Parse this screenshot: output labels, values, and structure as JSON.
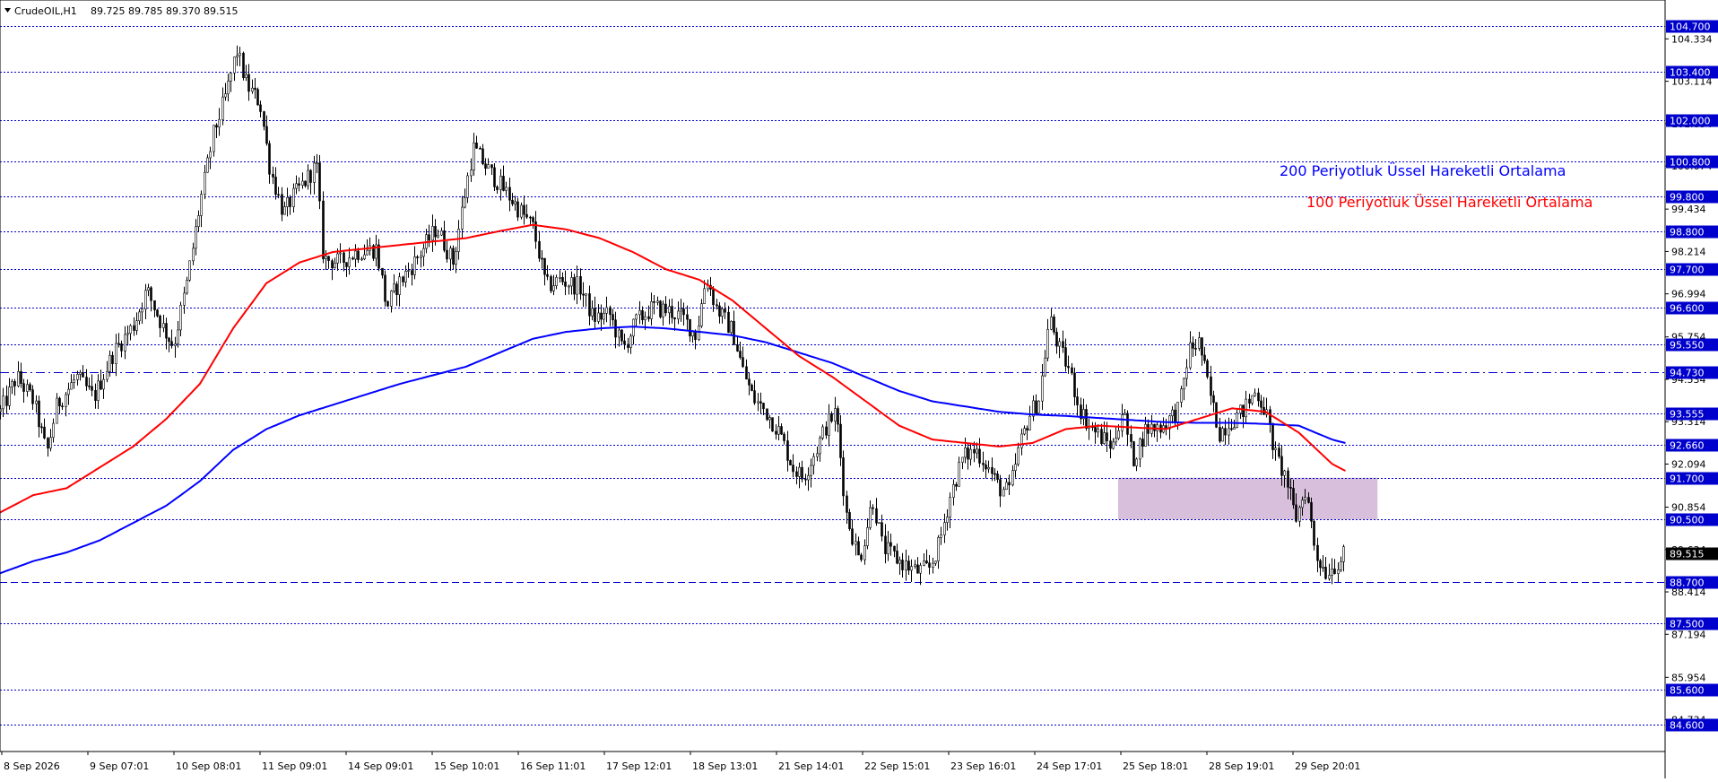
{
  "header": {
    "symbol": "CrudeOIL,H1",
    "ohlc": "89.725 89.785 89.370 89.515"
  },
  "colors": {
    "ema200": "#0000ff",
    "ema100": "#ff0000",
    "level_line": "#0000cc",
    "price_tag": "#0000cc",
    "current_tag": "#000000",
    "zone": "#d8c0dc",
    "candle": "#000000"
  },
  "annotations": {
    "ema200_label": "200 Periyotluk Üssel Hareketli Ortalama",
    "ema100_label": "100 Periyotluk Üssel Hareketli Ortalama"
  },
  "chart_data": {
    "type": "candlestick",
    "title": "",
    "ylim": [
      84.0,
      105.35
    ],
    "x_tick_labels": [
      "8 Sep 2026",
      "9 Sep 07:01",
      "10 Sep 08:01",
      "11 Sep 09:01",
      "14 Sep 09:01",
      "15 Sep 10:01",
      "16 Sep 11:01",
      "17 Sep 12:01",
      "18 Sep 13:01",
      "21 Sep 14:01",
      "22 Sep 15:01",
      "23 Sep 16:01",
      "24 Sep 17:01",
      "25 Sep 18:01",
      "28 Sep 19:01",
      "29 Sep 20:01"
    ],
    "y_tick_labels": [
      104.334,
      103.114,
      101.894,
      100.674,
      99.434,
      98.214,
      96.994,
      95.754,
      94.534,
      93.314,
      92.094,
      90.854,
      89.634,
      88.414,
      87.194,
      85.954,
      84.734
    ],
    "horizontal_levels": [
      {
        "value": "104.700",
        "style": "dotted"
      },
      {
        "value": "103.400",
        "style": "dotted"
      },
      {
        "value": "102.000",
        "style": "dotted"
      },
      {
        "value": "100.800",
        "style": "dotted"
      },
      {
        "value": "99.800",
        "style": "dotted"
      },
      {
        "value": "98.800",
        "style": "dotted"
      },
      {
        "value": "97.700",
        "style": "dotted"
      },
      {
        "value": "96.600",
        "style": "dotted"
      },
      {
        "value": "95.550",
        "style": "dotted"
      },
      {
        "value": "94.730",
        "style": "dashdot"
      },
      {
        "value": "93.555",
        "style": "dotted"
      },
      {
        "value": "92.660",
        "style": "dotted"
      },
      {
        "value": "91.700",
        "style": "dotted"
      },
      {
        "value": "90.500",
        "style": "dotted"
      },
      {
        "value": "88.700",
        "style": "dashed"
      },
      {
        "value": "87.500",
        "style": "dotted"
      },
      {
        "value": "85.600",
        "style": "dotted"
      },
      {
        "value": "84.600",
        "style": "dotted"
      }
    ],
    "current_price": "89.515",
    "zone": {
      "y_low": 90.5,
      "y_high": 91.7,
      "x_start_frac": 0.6715,
      "x_end_frac": 0.8273
    },
    "price_anchors": [
      [
        0.0,
        93.6
      ],
      [
        0.01,
        94.6
      ],
      [
        0.02,
        93.9
      ],
      [
        0.028,
        92.4
      ],
      [
        0.034,
        93.8
      ],
      [
        0.046,
        94.6
      ],
      [
        0.056,
        94.0
      ],
      [
        0.068,
        95.3
      ],
      [
        0.08,
        96.1
      ],
      [
        0.088,
        97.1
      ],
      [
        0.098,
        96.0
      ],
      [
        0.104,
        95.5
      ],
      [
        0.112,
        97.3
      ],
      [
        0.12,
        99.6
      ],
      [
        0.128,
        101.6
      ],
      [
        0.136,
        102.8
      ],
      [
        0.142,
        104.0
      ],
      [
        0.148,
        103.0
      ],
      [
        0.156,
        102.5
      ],
      [
        0.162,
        100.6
      ],
      [
        0.17,
        99.3
      ],
      [
        0.176,
        99.8
      ],
      [
        0.184,
        100.3
      ],
      [
        0.19,
        100.7
      ],
      [
        0.194,
        98.0
      ],
      [
        0.204,
        97.9
      ],
      [
        0.214,
        98.2
      ],
      [
        0.226,
        98.3
      ],
      [
        0.232,
        96.6
      ],
      [
        0.238,
        97.2
      ],
      [
        0.25,
        98.0
      ],
      [
        0.262,
        98.9
      ],
      [
        0.272,
        97.9
      ],
      [
        0.278,
        99.6
      ],
      [
        0.284,
        101.2
      ],
      [
        0.294,
        100.5
      ],
      [
        0.304,
        99.9
      ],
      [
        0.312,
        99.4
      ],
      [
        0.32,
        98.9
      ],
      [
        0.328,
        97.2
      ],
      [
        0.336,
        97.4
      ],
      [
        0.348,
        97.2
      ],
      [
        0.356,
        96.3
      ],
      [
        0.366,
        96.4
      ],
      [
        0.374,
        95.4
      ],
      [
        0.382,
        96.2
      ],
      [
        0.392,
        96.6
      ],
      [
        0.402,
        96.5
      ],
      [
        0.41,
        96.3
      ],
      [
        0.418,
        95.8
      ],
      [
        0.424,
        97.5
      ],
      [
        0.43,
        96.6
      ],
      [
        0.44,
        95.9
      ],
      [
        0.446,
        94.8
      ],
      [
        0.452,
        94.0
      ],
      [
        0.46,
        93.6
      ],
      [
        0.468,
        93.0
      ],
      [
        0.476,
        92.0
      ],
      [
        0.482,
        91.7
      ],
      [
        0.49,
        92.5
      ],
      [
        0.496,
        93.2
      ],
      [
        0.502,
        93.6
      ],
      [
        0.508,
        90.7
      ],
      [
        0.516,
        89.3
      ],
      [
        0.524,
        91.1
      ],
      [
        0.53,
        89.7
      ],
      [
        0.54,
        89.3
      ],
      [
        0.55,
        89.0
      ],
      [
        0.558,
        89.1
      ],
      [
        0.564,
        89.8
      ],
      [
        0.57,
        91.1
      ],
      [
        0.578,
        92.3
      ],
      [
        0.586,
        92.5
      ],
      [
        0.592,
        92.1
      ],
      [
        0.6,
        91.4
      ],
      [
        0.606,
        91.3
      ],
      [
        0.612,
        92.6
      ],
      [
        0.618,
        93.5
      ],
      [
        0.624,
        94.0
      ],
      [
        0.63,
        96.3
      ],
      [
        0.636,
        95.4
      ],
      [
        0.642,
        94.8
      ],
      [
        0.648,
        93.7
      ],
      [
        0.654,
        93.2
      ],
      [
        0.66,
        92.9
      ],
      [
        0.668,
        92.6
      ],
      [
        0.674,
        93.7
      ],
      [
        0.68,
        92.2
      ],
      [
        0.688,
        93.1
      ],
      [
        0.698,
        93.2
      ],
      [
        0.708,
        93.7
      ],
      [
        0.714,
        95.4
      ],
      [
        0.72,
        95.6
      ],
      [
        0.726,
        94.2
      ],
      [
        0.732,
        93.0
      ],
      [
        0.738,
        93.3
      ],
      [
        0.746,
        93.6
      ],
      [
        0.754,
        94.2
      ],
      [
        0.76,
        93.6
      ],
      [
        0.766,
        92.3
      ],
      [
        0.772,
        91.7
      ],
      [
        0.778,
        90.5
      ],
      [
        0.784,
        91.4
      ],
      [
        0.79,
        89.5
      ],
      [
        0.796,
        89.0
      ],
      [
        0.802,
        89.2
      ],
      [
        0.808,
        89.5
      ]
    ],
    "ema100_anchors": [
      [
        0.0,
        90.7
      ],
      [
        0.02,
        91.2
      ],
      [
        0.04,
        91.4
      ],
      [
        0.06,
        92.0
      ],
      [
        0.08,
        92.6
      ],
      [
        0.1,
        93.4
      ],
      [
        0.12,
        94.4
      ],
      [
        0.14,
        96.0
      ],
      [
        0.16,
        97.3
      ],
      [
        0.18,
        97.9
      ],
      [
        0.2,
        98.2
      ],
      [
        0.22,
        98.3
      ],
      [
        0.24,
        98.4
      ],
      [
        0.26,
        98.5
      ],
      [
        0.28,
        98.6
      ],
      [
        0.3,
        98.8
      ],
      [
        0.32,
        98.98
      ],
      [
        0.34,
        98.85
      ],
      [
        0.36,
        98.6
      ],
      [
        0.38,
        98.2
      ],
      [
        0.4,
        97.7
      ],
      [
        0.42,
        97.4
      ],
      [
        0.44,
        96.8
      ],
      [
        0.46,
        96.0
      ],
      [
        0.48,
        95.2
      ],
      [
        0.5,
        94.6
      ],
      [
        0.52,
        93.9
      ],
      [
        0.54,
        93.2
      ],
      [
        0.56,
        92.8
      ],
      [
        0.58,
        92.7
      ],
      [
        0.6,
        92.6
      ],
      [
        0.62,
        92.7
      ],
      [
        0.64,
        93.1
      ],
      [
        0.66,
        93.2
      ],
      [
        0.68,
        93.15
      ],
      [
        0.7,
        93.1
      ],
      [
        0.72,
        93.4
      ],
      [
        0.74,
        93.7
      ],
      [
        0.76,
        93.6
      ],
      [
        0.78,
        93.0
      ],
      [
        0.8,
        92.1
      ],
      [
        0.808,
        91.9
      ]
    ],
    "ema200_anchors": [
      [
        0.0,
        88.95
      ],
      [
        0.02,
        89.3
      ],
      [
        0.04,
        89.55
      ],
      [
        0.06,
        89.9
      ],
      [
        0.08,
        90.4
      ],
      [
        0.1,
        90.9
      ],
      [
        0.12,
        91.6
      ],
      [
        0.14,
        92.5
      ],
      [
        0.16,
        93.1
      ],
      [
        0.18,
        93.5
      ],
      [
        0.2,
        93.8
      ],
      [
        0.22,
        94.1
      ],
      [
        0.24,
        94.4
      ],
      [
        0.26,
        94.65
      ],
      [
        0.28,
        94.9
      ],
      [
        0.3,
        95.3
      ],
      [
        0.32,
        95.7
      ],
      [
        0.34,
        95.9
      ],
      [
        0.36,
        96.0
      ],
      [
        0.38,
        96.05
      ],
      [
        0.4,
        96.0
      ],
      [
        0.42,
        95.9
      ],
      [
        0.44,
        95.8
      ],
      [
        0.46,
        95.6
      ],
      [
        0.48,
        95.3
      ],
      [
        0.5,
        95.0
      ],
      [
        0.52,
        94.6
      ],
      [
        0.54,
        94.2
      ],
      [
        0.56,
        93.9
      ],
      [
        0.58,
        93.75
      ],
      [
        0.6,
        93.6
      ],
      [
        0.62,
        93.52
      ],
      [
        0.64,
        93.48
      ],
      [
        0.66,
        93.42
      ],
      [
        0.68,
        93.36
      ],
      [
        0.7,
        93.3
      ],
      [
        0.72,
        93.28
      ],
      [
        0.74,
        93.28
      ],
      [
        0.76,
        93.25
      ],
      [
        0.78,
        93.2
      ],
      [
        0.8,
        92.8
      ],
      [
        0.808,
        92.7
      ]
    ]
  }
}
